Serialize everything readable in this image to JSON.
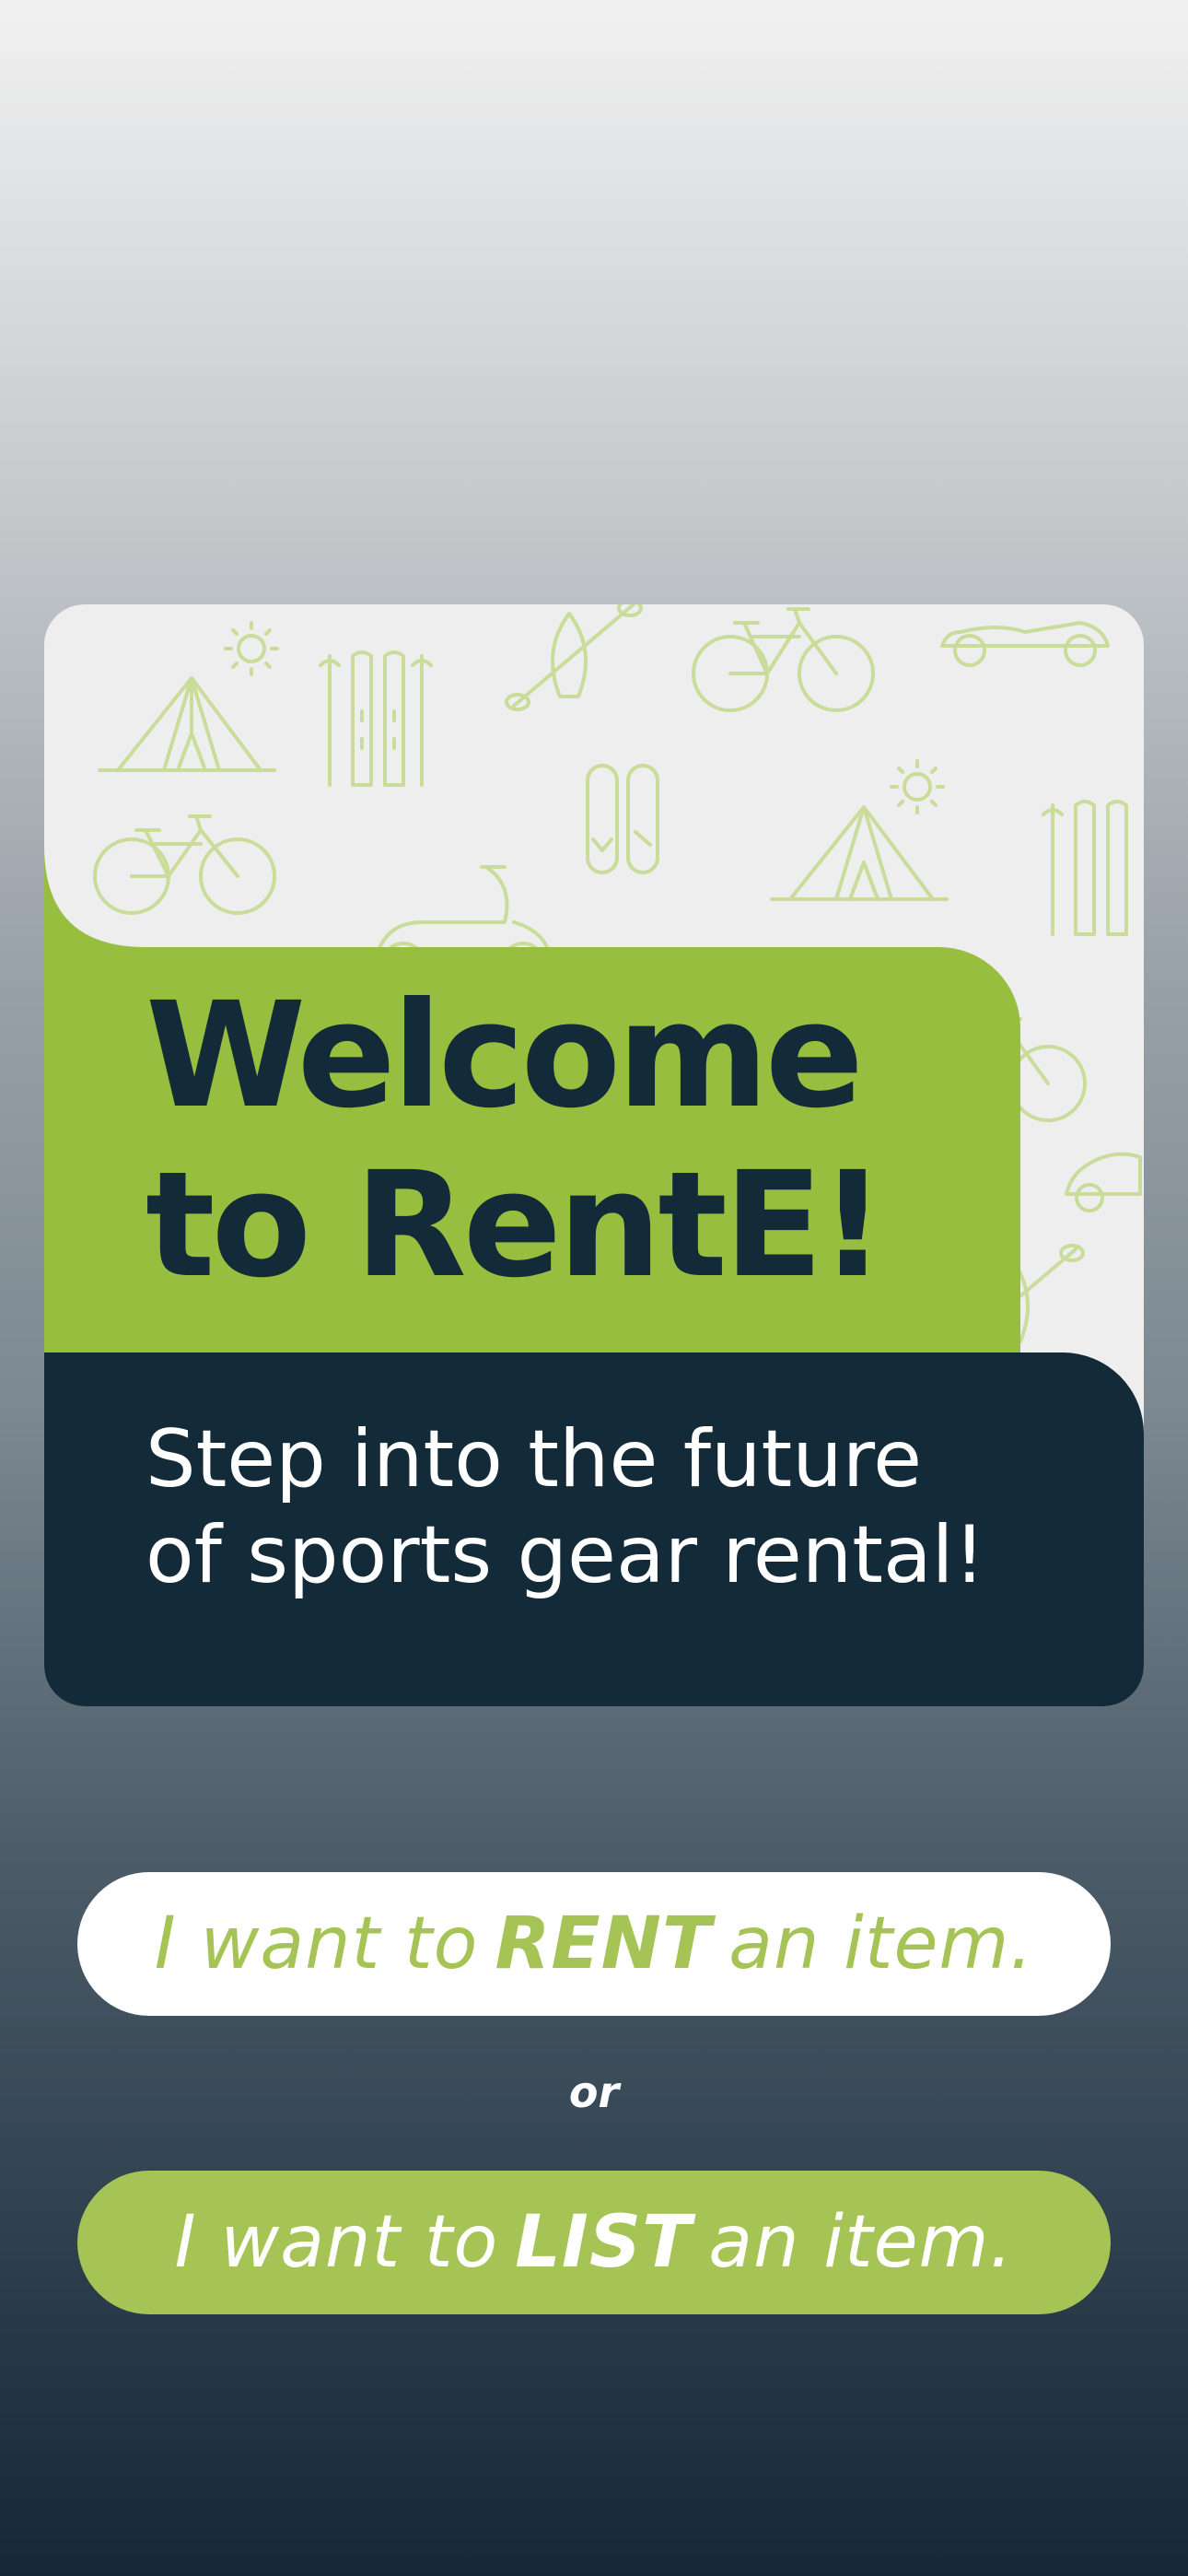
{
  "welcome": {
    "line1": "Welcome",
    "line2": "to RentE!"
  },
  "tagline": {
    "line1": "Step into the future",
    "line2": "of sports gear rental!"
  },
  "rent_button": {
    "prefix": "I want to",
    "keyword": "RENT",
    "suffix": "an item."
  },
  "separator": "or",
  "list_button": {
    "prefix": "I want to",
    "keyword": "LIST",
    "suffix": "an item."
  },
  "pattern_icons": [
    "tent-icon",
    "sun-icon",
    "skis-icon",
    "kayak-icon",
    "bicycle-icon",
    "scooter-icon",
    "snowboard-icon"
  ],
  "colors": {
    "brand_green": "#98be40",
    "button_green": "#a6c456",
    "navy": "#132a38",
    "card_bg": "#eeeeee",
    "icon_outline": "#c9dc9a"
  }
}
